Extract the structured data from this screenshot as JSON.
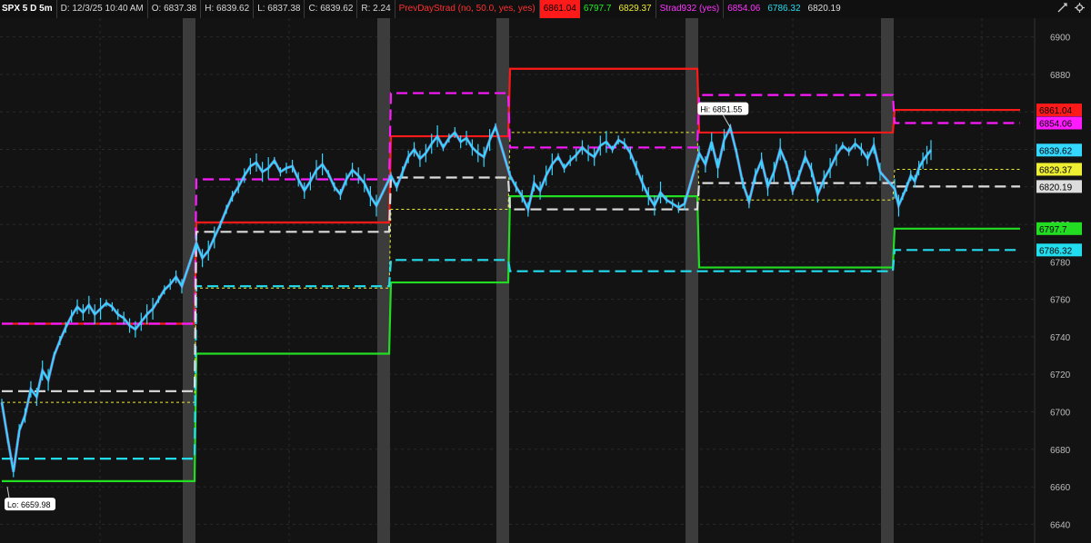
{
  "header": {
    "symbol": "SPX 5 D 5m",
    "date": "D: 12/3/25 10:40 AM",
    "open": "O: 6837.38",
    "high": "H: 6839.62",
    "low": "L: 6837.38",
    "close": "C: 6839.62",
    "range": "R: 2.24",
    "study1_name": "PrevDayStrad (no, 50.0, yes, yes)",
    "study1_v1": "6861.04",
    "study1_v2": "6797.7",
    "study1_v3": "6829.37",
    "study2_name": "Strad932 (yes)",
    "study2_v1": "6854.06",
    "study2_v2": "6786.32",
    "study2_v3": "6820.19"
  },
  "colors": {
    "bg": "#131313",
    "grid": "#2a2a2a",
    "session_break": "#3c3c3c",
    "price": "#33d7ff",
    "price_alt": "#e070ff",
    "upper_red": "#ff1a1a",
    "upper_magenta": "#ff1aff",
    "lower_green": "#22dd22",
    "lower_cyan": "#22ddee",
    "mid_white": "#dddddd",
    "mid_yellow": "#eeee33"
  },
  "chart_data": {
    "type": "line",
    "title": "SPX 5 D 5m",
    "ylim": [
      6630,
      6910
    ],
    "y_ticks": [
      6900,
      6880,
      6860,
      6840,
      6820,
      6800,
      6780,
      6760,
      6740,
      6720,
      6700,
      6680,
      6660,
      6640
    ],
    "grid": true,
    "sessions": 5,
    "hi_label": "Hi: 6851.55",
    "lo_label": "Lo: 6659.98",
    "levels": [
      {
        "name": "PrevDayStrad upper",
        "color": "#ff1a1a",
        "style": "solid",
        "values": [
          6747,
          6801,
          6847,
          6883,
          6849,
          6861.04
        ]
      },
      {
        "name": "PrevDayStrad lower",
        "color": "#22dd22",
        "style": "solid",
        "values": [
          6663,
          6731,
          6769,
          6815,
          6777,
          6797.7
        ]
      },
      {
        "name": "PrevDayStrad mid",
        "color": "#eeee33",
        "style": "dotted",
        "values": [
          6705,
          6766,
          6808,
          6849,
          6813,
          6829.37
        ]
      },
      {
        "name": "Strad932 upper",
        "color": "#ff1aff",
        "style": "dashed",
        "values": [
          6747,
          6824,
          6870,
          6841,
          6869,
          6854.06
        ]
      },
      {
        "name": "Strad932 lower",
        "color": "#22ddee",
        "style": "dashed",
        "values": [
          6675,
          6767,
          6781,
          6775,
          6775,
          6786.32
        ]
      },
      {
        "name": "Strad932 mid",
        "color": "#dddddd",
        "style": "dashed",
        "values": [
          6711,
          6796,
          6825,
          6808,
          6822,
          6820.19
        ]
      }
    ],
    "price_path": [
      6705,
      6686,
      6668,
      6690,
      6698,
      6712,
      6708,
      6722,
      6717,
      6730,
      6738,
      6745,
      6751,
      6756,
      6753,
      6757,
      6752,
      6755,
      6758,
      6756,
      6752,
      6750,
      6746,
      6744,
      6748,
      6752,
      6755,
      6760,
      6765,
      6768,
      6772,
      6767,
      6790,
      6782,
      6786,
      6793,
      6800,
      6808,
      6815,
      6820,
      6826,
      6831,
      6833,
      6828,
      6830,
      6834,
      6828,
      6830,
      6831,
      6824,
      6818,
      6823,
      6829,
      6832,
      6827,
      6820,
      6816,
      6824,
      6829,
      6826,
      6822,
      6815,
      6810,
      6826,
      6820,
      6828,
      6836,
      6840,
      6835,
      6838,
      6843,
      6847,
      6841,
      6846,
      6849,
      6844,
      6846,
      6841,
      6838,
      6836,
      6845,
      6852,
      6826,
      6820,
      6815,
      6808,
      6822,
      6818,
      6826,
      6832,
      6836,
      6830,
      6834,
      6837,
      6841,
      6838,
      6836,
      6842,
      6844,
      6840,
      6845,
      6843,
      6838,
      6830,
      6822,
      6815,
      6810,
      6817,
      6813,
      6811,
      6809,
      6811,
      6838,
      6832,
      6844,
      6830,
      6845,
      6851.55,
      6838,
      6822,
      6812,
      6826,
      6834,
      6820,
      6828,
      6840,
      6832,
      6818,
      6826,
      6836,
      6829,
      6816,
      6824,
      6830,
      6837,
      6842,
      6839,
      6843,
      6840,
      6835,
      6842,
      6828,
      6819,
      6810,
      6815,
      6820,
      6826,
      6823,
      6830,
      6834,
      6837,
      6839.62
    ],
    "session_bar_counts": [
      32,
      31,
      19,
      30,
      30,
      10
    ],
    "tags": [
      {
        "value": 6861.04,
        "label": "6861.04",
        "color": "#ff1a1a"
      },
      {
        "value": 6854.06,
        "label": "6854.06",
        "color": "#ff1aff"
      },
      {
        "value": 6839.62,
        "label": "6839.62",
        "color": "#33d7ff"
      },
      {
        "value": 6829.37,
        "label": "6829.37",
        "color": "#eeee33"
      },
      {
        "value": 6820.19,
        "label": "6820.19",
        "color": "#dddddd"
      },
      {
        "value": 6797.7,
        "label": "6797.7",
        "color": "#22dd22"
      },
      {
        "value": 6786.32,
        "label": "6786.32",
        "color": "#22ddee"
      }
    ]
  }
}
